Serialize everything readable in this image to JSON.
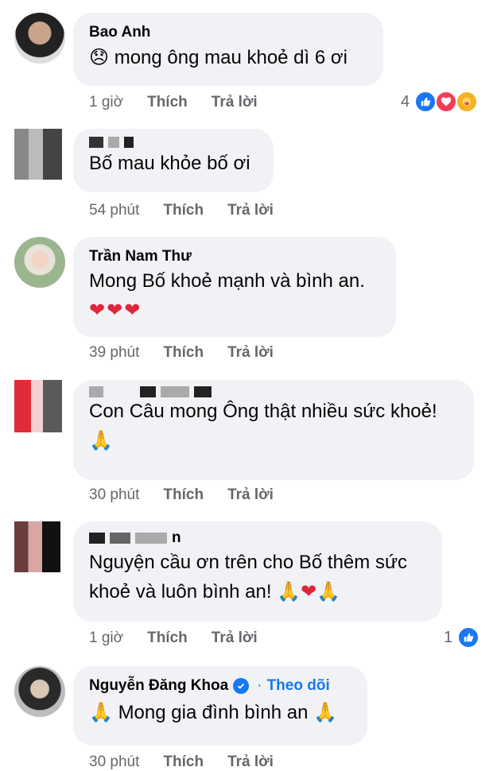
{
  "comments": [
    {
      "author": "Bao Anh",
      "text": "mong ông mau khoẻ dì 6 ơi",
      "emoji_prefix": "😞",
      "time": "1 giờ",
      "like": "Thích",
      "reply": "Trả lời",
      "reactions": "4"
    },
    {
      "author": "",
      "text": "Bố mau khỏe bố ơi",
      "time": "54 phút",
      "like": "Thích",
      "reply": "Trả lời"
    },
    {
      "author": "Trần Nam Thư",
      "text": "Mong Bố khoẻ mạnh và bình an.",
      "emoji_line": "❤❤❤",
      "time": "39 phút",
      "like": "Thích",
      "reply": "Trả lời"
    },
    {
      "author": "",
      "text": "Con Câu mong Ông thật nhiều sức khoẻ!",
      "emoji_line": "🙏",
      "time": "30 phút",
      "like": "Thích",
      "reply": "Trả lời"
    },
    {
      "author": "",
      "author_partial": "n",
      "text_line1": "Nguyện cầu ơn trên cho Bố thêm sức",
      "text_line2": "khoẻ và luôn bình an!",
      "emoji_suffix": "🙏❤🙏",
      "time": "1 giờ",
      "like": "Thích",
      "reply": "Trả lời",
      "reactions": "1"
    },
    {
      "author": "Nguyễn Đăng Khoa",
      "follow_sep": "·",
      "follow": "Theo dõi",
      "text": "Mong gia đình bình an",
      "emoji_prefix": "🙏",
      "emoji_suffix": "🙏",
      "time": "30 phút",
      "like": "Thích",
      "reply": "Trả lời"
    }
  ],
  "colors": {
    "bubble": "#f0f2f5",
    "meta": "#65676b",
    "accent": "#1877f2"
  }
}
